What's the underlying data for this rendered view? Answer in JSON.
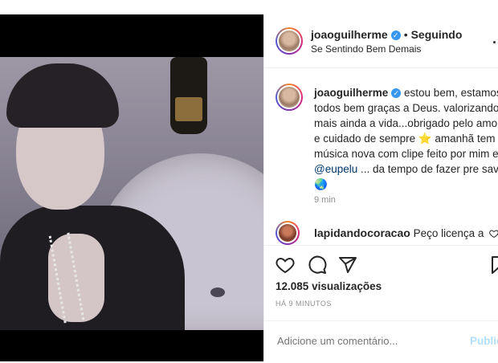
{
  "header": {
    "username": "joaoguilherme",
    "separator": "•",
    "follow_status": "Seguindo",
    "subtitle": "Se Sentindo Bem Demais",
    "more": "..."
  },
  "caption": {
    "username": "joaoguilherme",
    "text_part1": "estou bem, estamos todos bem graças a Deus. valorizando mais ainda a vida...obrigado pelo amor e cuidado de sempre ",
    "star": "⭐",
    "text_part2": " amanhã tem música nova com clipe feito por mim e ",
    "mention": "@eupelu",
    "text_part3": " ... da tempo de fazer pre save ",
    "globe": "🌏",
    "time": "9 min"
  },
  "comment": {
    "username": "lapidandocoracao",
    "text": "Peço licença a"
  },
  "stats": {
    "views_count": "12.085",
    "views_label": "visualizações",
    "ago": "HÁ 9 MINUTOS"
  },
  "add_comment": {
    "placeholder": "Adicione um comentário...",
    "publish": "Publicar"
  },
  "colors": {
    "verified": "#3897f0",
    "publish": "#b2dffc",
    "link": "#00376b"
  }
}
